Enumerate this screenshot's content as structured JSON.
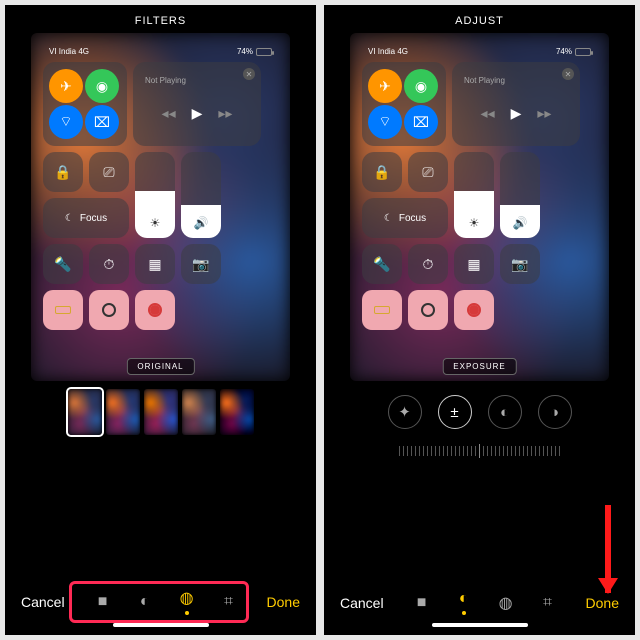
{
  "left": {
    "mode": "FILTERS",
    "chip": "ORIGINAL",
    "cancel": "Cancel",
    "done": "Done"
  },
  "right": {
    "mode": "ADJUST",
    "chip": "EXPOSURE",
    "cancel": "Cancel",
    "done": "Done"
  },
  "cc": {
    "carrier": "VI India 4G",
    "battery_pct": "74%",
    "not_playing": "Not Playing",
    "focus": "Focus"
  }
}
